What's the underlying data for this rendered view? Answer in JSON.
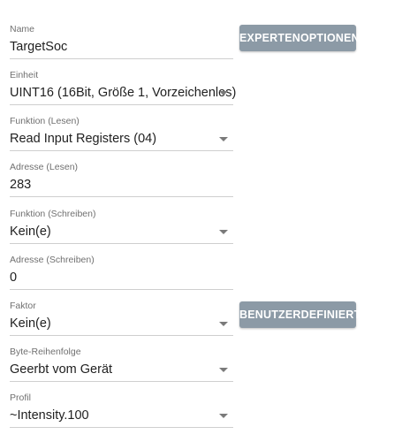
{
  "fields": [
    {
      "label": "Name",
      "value": "TargetSoc",
      "kind": "text"
    },
    {
      "label": "Einheit",
      "value": "UINT16 (16Bit, Größe 1, Vorzeichenlos)",
      "kind": "select"
    },
    {
      "label": "Funktion (Lesen)",
      "value": "Read Input Registers (04)",
      "kind": "select"
    },
    {
      "label": "Adresse (Lesen)",
      "value": "283",
      "kind": "text"
    },
    {
      "label": "Funktion (Schreiben)",
      "value": "Kein(e)",
      "kind": "select"
    },
    {
      "label": "Adresse (Schreiben)",
      "value": "0",
      "kind": "text"
    },
    {
      "label": "Faktor",
      "value": "Kein(e)",
      "kind": "select"
    },
    {
      "label": "Byte-Reihenfolge",
      "value": "Geerbt vom Gerät",
      "kind": "select"
    },
    {
      "label": "Profil",
      "value": "~Intensity.100",
      "kind": "select"
    }
  ],
  "buttons": {
    "expert_options": "EXPERTENOPTIONEN",
    "custom": "BENUTZERDEFINIERT"
  },
  "colors": {
    "button_bg": "#8c9aa6",
    "label": "#707070",
    "underline": "#cfcfcf"
  },
  "icons": {
    "select_caret": "caret-down-icon"
  }
}
